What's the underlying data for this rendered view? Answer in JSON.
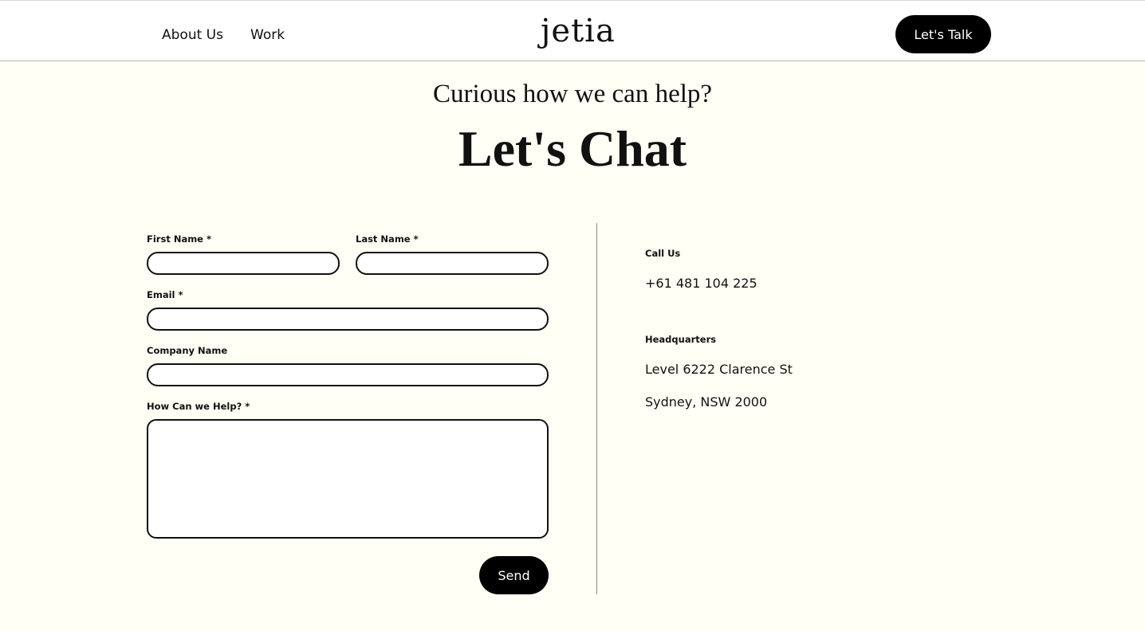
{
  "nav": {
    "links": [
      "About Us",
      "Work"
    ],
    "logo": "jetia",
    "cta_label": "Let's Talk"
  },
  "hero": {
    "subheading": "Curious how we can help?",
    "heading": "Let's Chat"
  },
  "form": {
    "first_name_label": "First Name *",
    "last_name_label": "Last Name *",
    "email_label": "Email *",
    "company_label": "Company Name",
    "message_label": "How Can we Help? *",
    "send_label": "Send"
  },
  "contact": {
    "call_heading": "Call Us",
    "phone": "+61 481 104 225",
    "hq_heading": "Headquarters",
    "address_line1": "Level 6222 Clarence St",
    "address_line2": "Sydney, NSW 2000"
  },
  "colors": {
    "background": "#fffff5",
    "accent": "#000000"
  }
}
